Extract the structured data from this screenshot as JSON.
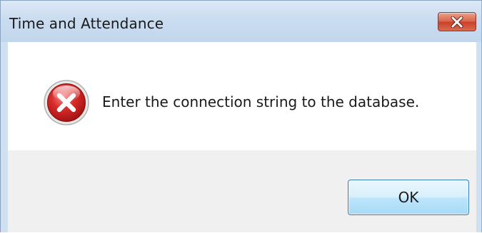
{
  "window": {
    "title": "Time and Attendance",
    "close_icon": "close-icon",
    "close_color": "#c8412a"
  },
  "message": {
    "icon": "error-icon",
    "icon_color": "#c81e1e",
    "text": "Enter the connection string to the database."
  },
  "buttons": {
    "ok_label": "OK"
  }
}
